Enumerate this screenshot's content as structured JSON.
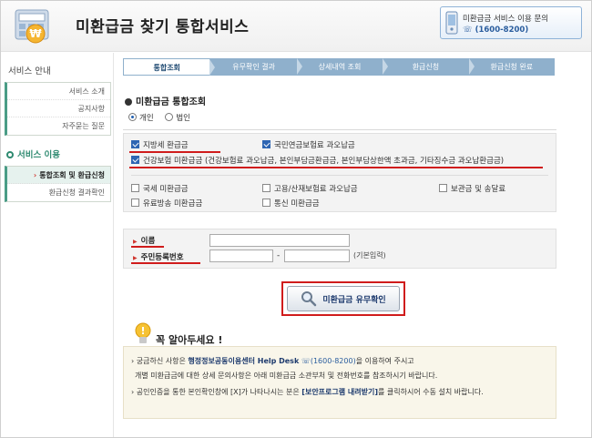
{
  "header": {
    "site_title": "미환급금 찾기 통합서비스",
    "inquiry_label": "미환급금 서비스 이용 문의",
    "inquiry_phone": "(1600-8200)"
  },
  "sidebar": {
    "guide_heading": "서비스 안내",
    "guide_items": [
      "서비스 소개",
      "공지사항",
      "자주묻는 질문"
    ],
    "service_heading": "서비스 이용",
    "service_items": [
      "통합조회 및 환급신청",
      "환급신청 결과확인"
    ]
  },
  "steps": [
    "통합조회",
    "유무확인 결과",
    "상세내역 조회",
    "환급신청",
    "환급신청 완료"
  ],
  "section_title": "미환급금 통합조회",
  "person_type": {
    "options": [
      "개인",
      "법인"
    ],
    "selected": "개인"
  },
  "checkboxes": {
    "local_tax": {
      "label": "지방세 환급금",
      "checked": true
    },
    "pension": {
      "label": "국민연금보험료 과오납금",
      "checked": true
    },
    "health": {
      "label": "건강보험 미환급금 (건강보험료 과오납금, 본인부담금환급금, 본인부담상한액 초과금, 기타징수금 과오납환급금)",
      "checked": true
    },
    "national_tax": {
      "label": "국세 미환급금",
      "checked": false
    },
    "employment": {
      "label": "고용/산재보험료 과오납금",
      "checked": false
    },
    "deposit": {
      "label": "보관금 및 송달료",
      "checked": false
    },
    "broadcast": {
      "label": "유료방송 미환급금",
      "checked": false
    },
    "telecom": {
      "label": "통신 미환급금",
      "checked": false
    }
  },
  "identity": {
    "name_label": "이름",
    "rrn_label": "주민등록번호",
    "rrn_separator": "-",
    "rrn_hint": "(기본입력)",
    "name_value": "",
    "rrn_front": "",
    "rrn_back": ""
  },
  "check_button": "미환급금 유무확인",
  "notice": {
    "title": "꼭 알아두세요 !",
    "line1_a": "궁금하신 사항은 ",
    "line1_em": "행정정보공동이용센터 Help Desk",
    "line1_phone": "(1600-8200)",
    "line1_b": "을 이용하여 주시고",
    "line2": "개별 미환급금에 대한 상세 문의사항은 아래 미환급금 소관부처 및 전화번호를 참조하시기 바랍니다.",
    "line3_a": "공인인증을 통한 본인확인창에 [X]가 나타나시는 분은 ",
    "line3_link": "[보안프로그램 내려받기]",
    "line3_b": "를 클릭하시어 수동 설치 바랍니다."
  },
  "colors": {
    "accent_red": "#d01c1c",
    "step_bar": "#8fb0cc",
    "sidebar_accent": "#4a9c86",
    "notice_bg": "#f9f6ea"
  }
}
